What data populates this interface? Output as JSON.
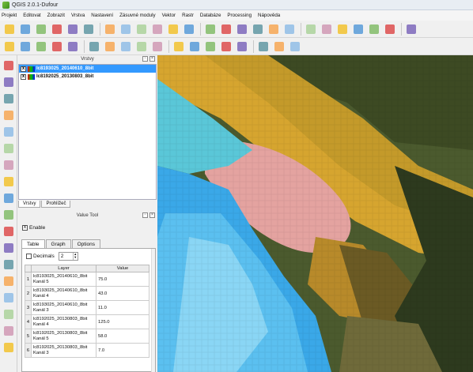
{
  "window": {
    "title": "QGIS 2.0.1-Dufour"
  },
  "menu": [
    "Projekt",
    "Editovat",
    "Zobrazit",
    "Vrstva",
    "Nastavení",
    "Zásuvné moduly",
    "Vektor",
    "Rastr",
    "Databáze",
    "Processing",
    "Nápověda"
  ],
  "layers_panel": {
    "title": "Vrstvy",
    "layers": [
      {
        "name": "lc8193025_20140610_8bit",
        "checked": "x",
        "selected": true
      },
      {
        "name": "lc8192025_20130803_8bit",
        "checked": "x",
        "selected": false
      }
    ],
    "tabs": [
      "Vrstvy",
      "Prohlížeč"
    ]
  },
  "value_tool": {
    "title": "Value Tool",
    "enable_label": "Enable",
    "enable_checked": "x",
    "tabs": [
      "Table",
      "Graph",
      "Options"
    ],
    "decimals_label": "Decimals",
    "decimals_value": "2",
    "columns": [
      "Layer",
      "Value"
    ],
    "rows": [
      {
        "idx": "1",
        "layer": "lc8193025_20140610_8bit",
        "band": "Kanál 5",
        "value": "75.0"
      },
      {
        "idx": "2",
        "layer": "lc8193025_20140610_8bit",
        "band": "Kanál 4",
        "value": "43.0"
      },
      {
        "idx": "3",
        "layer": "lc8193025_20140610_8bit",
        "band": "Kanál 3",
        "value": "11.0"
      },
      {
        "idx": "4",
        "layer": "lc8192025_20130803_8bit",
        "band": "Kanál 4",
        "value": "125.0"
      },
      {
        "idx": "5",
        "layer": "lc8192025_20130803_8bit",
        "band": "Kanál 5",
        "value": "58.0"
      },
      {
        "idx": "6",
        "layer": "lc8192025_20130803_8bit",
        "band": "Kanál 3",
        "value": "7.0"
      }
    ]
  },
  "toolbar1_icons": [
    "new-project-icon",
    "open-project-icon",
    "save-project-icon",
    "save-as-icon",
    "new-print-composer-icon",
    "composer-manager-icon",
    "pan-icon",
    "pan-to-selection-icon",
    "zoom-in-icon",
    "zoom-out-icon",
    "zoom-full-icon",
    "zoom-to-layer-icon",
    "zoom-to-selection-icon",
    "zoom-last-icon",
    "zoom-next-icon",
    "refresh-icon",
    "identify-icon",
    "select-icon",
    "deselect-icon",
    "field-calculator-icon",
    "measure-icon",
    "attribute-table-icon",
    "statistics-icon",
    "annotation-icon",
    "tip-icon"
  ],
  "toolbar2_icons": [
    "current-edits-icon",
    "toggle-editing-icon",
    "save-edits-icon",
    "add-feature-icon",
    "move-feature-icon",
    "node-tool-icon",
    "delete-selected-icon",
    "cut-features-icon",
    "copy-features-icon",
    "paste-features-icon",
    "label-icon",
    "label-pin-icon",
    "label-highlight-icon",
    "label-show-hide-icon",
    "label-move-icon",
    "label-rotate-icon",
    "label-change-icon",
    "value-tool-icon"
  ],
  "left_tools": [
    "add-vector-layer-icon",
    "add-raster-layer-icon",
    "add-postgis-layer-icon",
    "add-spatialite-layer-icon",
    "add-mssql-layer-icon",
    "add-oracle-layer-icon",
    "add-wms-layer-icon",
    "add-wcs-layer-icon",
    "add-wfs-layer-icon",
    "add-delimited-text-icon",
    "new-shapefile-icon",
    "new-spatialite-icon",
    "new-temporary-layer-icon",
    "add-gps-icon",
    "remove-layer-icon",
    "gps-tools-icon",
    "digitize-icon",
    "oracle-spatial-icon"
  ]
}
